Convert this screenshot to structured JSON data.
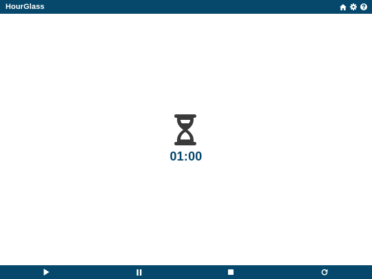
{
  "app": {
    "title": "HourGlass"
  },
  "header": {
    "icons": [
      "home-icon",
      "gear-icon",
      "help-icon"
    ]
  },
  "timer": {
    "display": "01:00",
    "icon": "hourglass-icon"
  },
  "controls": {
    "icons": [
      "play-icon",
      "pause-icon",
      "stop-icon",
      "reset-icon"
    ]
  },
  "colors": {
    "primary": "#05486b",
    "icon": "#3a3a3a",
    "background": "#ffffff"
  }
}
